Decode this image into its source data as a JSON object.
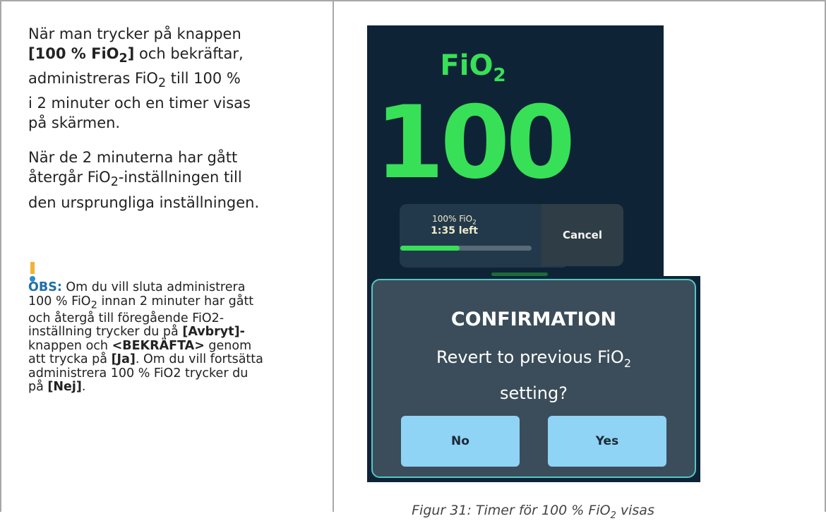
{
  "left_column": {
    "para1": {
      "t1": "När man trycker på knappen",
      "t2": "[100 % FiO",
      "t2_sub": "2",
      "t2_end": "]",
      "t3": " och bekräftar,",
      "t4": "administreras FiO",
      "t4_sub": "2",
      "t5": " till 100 %",
      "t6": "i 2 minuter och en timer visas",
      "t7": "på skärmen."
    },
    "para2": {
      "t1": "När de 2 minuterna har gått",
      "t2": "återgår FiO",
      "t2_sub": "2",
      "t3": "-inställningen till",
      "t4": "den ursprungliga inställningen."
    },
    "note": {
      "label": "OBS:",
      "t1": " Om du vill sluta administrera",
      "t2": "100 % FiO",
      "t2_sub": "2",
      "t3": " innan 2 minuter har gått",
      "t4": "och återgå till föregående FiO2-",
      "t5": "inställning trycker du på ",
      "b1": "[Avbryt]-",
      "t6": "knappen och ",
      "b2": "<BEKRÄFTA>",
      "t7": " genom",
      "t8": "att trycka på ",
      "b3": "[Ja]",
      "t9": ". Om du vill fortsätta",
      "t10": "administrera 100 % FiO2 trycker du",
      "t11": "på ",
      "b4": "[Nej]",
      "t12": ".",
      "icon": "exclamation-icon"
    }
  },
  "screen": {
    "title": "FiO",
    "title_sub": "2",
    "value": "100",
    "timer_label": "100% FiO",
    "timer_label_sub": "2",
    "timer_remaining": "1:35 left",
    "progress_fraction": 0.45,
    "cancel_label": "Cancel"
  },
  "dialog": {
    "title": "CONFIRMATION",
    "question_1": "Revert to previous FiO",
    "question_sub": "2",
    "question_2": "setting?",
    "no_label": "No",
    "yes_label": "Yes"
  },
  "caption": {
    "text": "Figur 31: Timer för 100 % FiO",
    "sub": "2",
    "text_end": " visas"
  },
  "colors": {
    "screen_bg": "#0e2436",
    "accent_green": "#38e057",
    "button_blue": "#8fd3f5",
    "dialog_border": "#54c6c6",
    "note_label": "#1f6fa8"
  }
}
